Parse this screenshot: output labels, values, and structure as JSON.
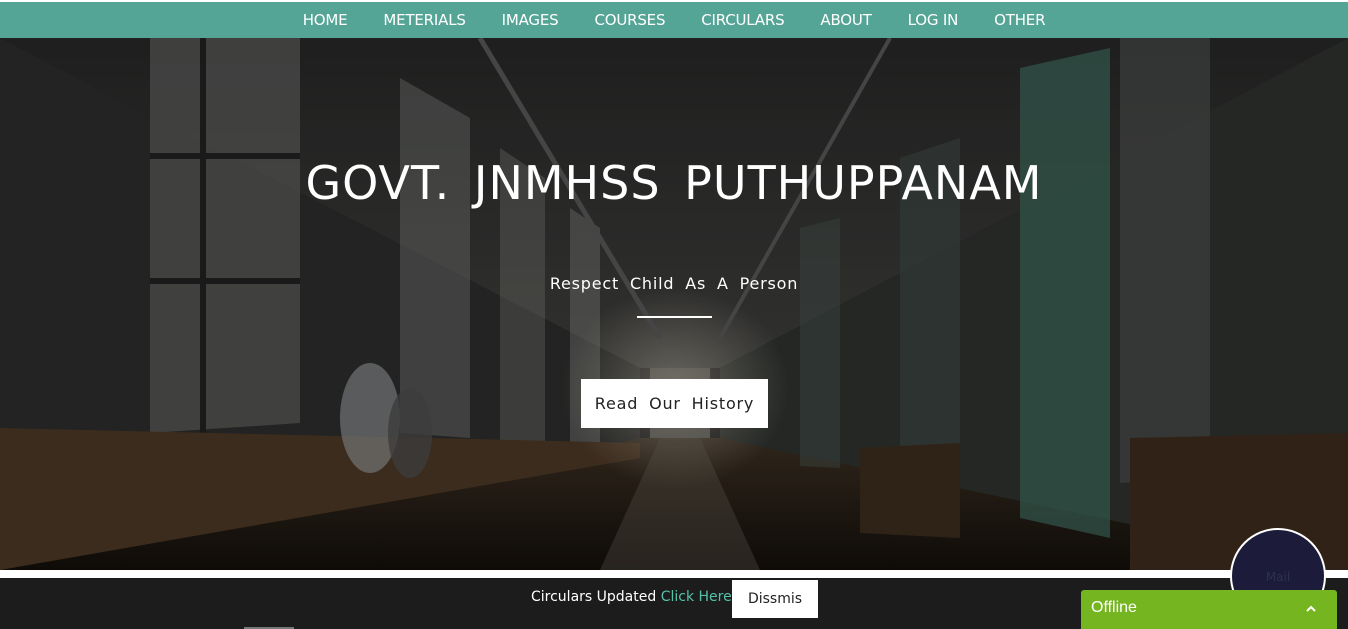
{
  "nav": {
    "items": [
      {
        "label": "HOME"
      },
      {
        "label": "METERIALS"
      },
      {
        "label": "IMAGES"
      },
      {
        "label": "COURSES"
      },
      {
        "label": "CIRCULARS"
      },
      {
        "label": "ABOUT"
      },
      {
        "label": "LOG IN"
      },
      {
        "label": "OTHER"
      }
    ]
  },
  "hero": {
    "title": "GOVT. JNMHSS PUTHUPPANAM",
    "tagline": "Respect Child As A Person",
    "button_label": "Read Our History"
  },
  "notice": {
    "text": "Circulars Updated",
    "link_label": "Click Here",
    "dismiss_label": "Dissmis"
  },
  "mail": {
    "label": "Mail"
  },
  "chat": {
    "status": "Offline",
    "icon": "chevron-up-icon"
  },
  "colors": {
    "nav_bg": "#55a597",
    "link": "#55c2a8",
    "chat_bg": "#74b520",
    "notice_bg": "#1c1c1c"
  }
}
